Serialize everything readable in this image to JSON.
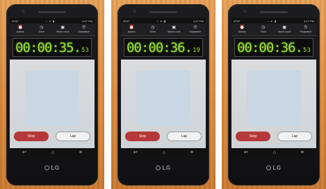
{
  "photos": [
    {
      "status": {
        "carrier": "AT&T",
        "icons": "♪ ▾ ▮",
        "time": "4:47 PM"
      },
      "tabs": [
        {
          "label": "Alarms",
          "icon": "alarm-icon"
        },
        {
          "label": "Timer",
          "icon": "timer-icon"
        },
        {
          "label": "World clock",
          "icon": "world-clock-icon"
        },
        {
          "label": "Stopwatch",
          "icon": "stopwatch-icon"
        }
      ],
      "stopwatch": {
        "main": "00:00:35.",
        "fraction": "53"
      },
      "buttons": {
        "stop": "Stop",
        "lap": "Lap"
      },
      "brand": "LG"
    },
    {
      "status": {
        "carrier": "AT&T",
        "icons": "♪ ▾ ▮",
        "time": "4:47 PM"
      },
      "tabs": [
        {
          "label": "Alarms",
          "icon": "alarm-icon"
        },
        {
          "label": "Timer",
          "icon": "timer-icon"
        },
        {
          "label": "World clock",
          "icon": "world-clock-icon"
        },
        {
          "label": "Stopwatch",
          "icon": "stopwatch-icon"
        }
      ],
      "stopwatch": {
        "main": "00:00:36.",
        "fraction": "19"
      },
      "buttons": {
        "stop": "Stop",
        "lap": "Lap"
      },
      "brand": "LG"
    },
    {
      "status": {
        "carrier": "AT&T",
        "icons": "♪ ▾ ▮",
        "time": "4:47 PM"
      },
      "tabs": [
        {
          "label": "Alarms",
          "icon": "alarm-icon"
        },
        {
          "label": "Timer",
          "icon": "timer-icon"
        },
        {
          "label": "World clock",
          "icon": "world-clock-icon"
        },
        {
          "label": "Stopwatch",
          "icon": "stopwatch-icon"
        }
      ],
      "stopwatch": {
        "main": "00:00:36.",
        "fraction": "53"
      },
      "buttons": {
        "stop": "Stop",
        "lap": "Lap"
      },
      "brand": "LG"
    }
  ],
  "colors": {
    "lcd_digits": "#9be13a",
    "stop_button": "#b5383a",
    "wood": "#d98a3f"
  }
}
